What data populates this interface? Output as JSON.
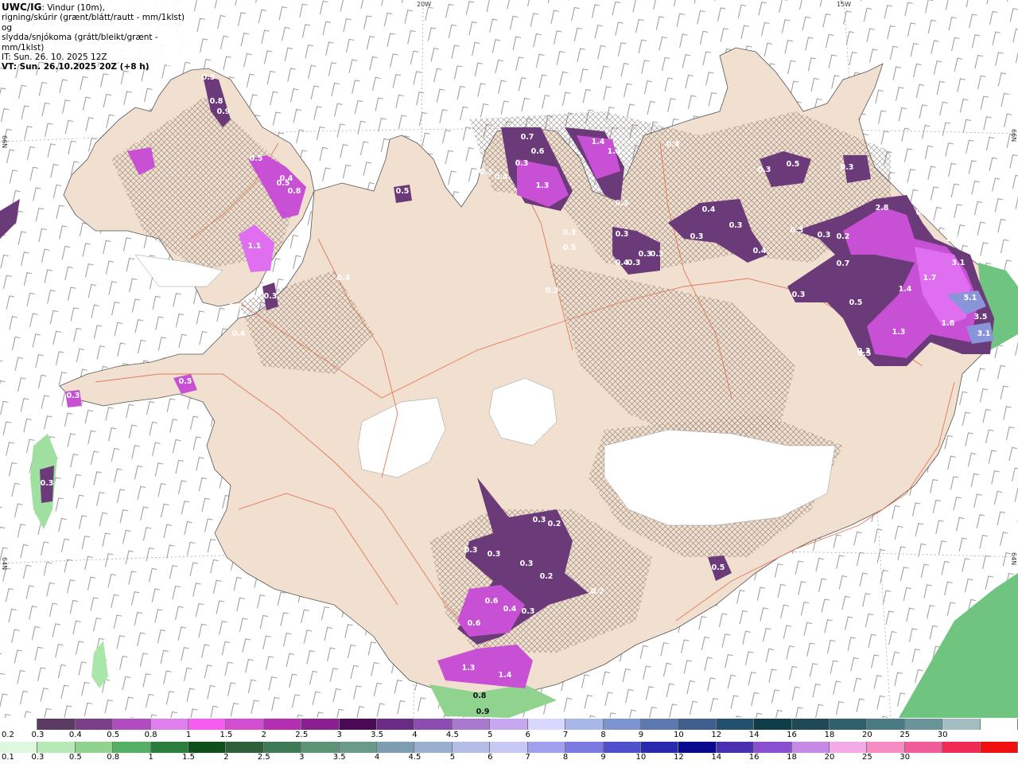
{
  "header": {
    "title": "UWC/IG",
    "title_rest": ": Vindur (10m),",
    "line2": "rigning/skúrir (grænt/blátt/rautt - mm/1klst) og",
    "line3": "slydda/snjókoma (grátt/bleikt/grænt - mm/1klst)",
    "it": "IT: Sun. 26. 10. 2025 12Z",
    "vt": "VT: Sun. 26.10.2025 20Z (+8 h)"
  },
  "coords": {
    "lon_20w": "20W",
    "lon_15w": "15W",
    "lat_66n_left": "66N",
    "lat_66n_right": "66N",
    "lat_64n_left": "64N",
    "lat_64n_right": "64N"
  },
  "precip_labels": [
    "0.4",
    "0.5",
    "0.8",
    "0.9",
    "0.3",
    "0.5",
    "0.4",
    "0.8",
    "0.5",
    "1.1",
    "0.3",
    "0.4",
    "0.5",
    "0.3",
    "0.8",
    "0.7",
    "0.6",
    "0.3",
    "0.4",
    "1.3",
    "0.3",
    "1.4",
    "1.4",
    "0.3",
    "0.4",
    "0.3",
    "0.5",
    "0.3",
    "0.3",
    "0.4",
    "0.3",
    "0.4",
    "0.3",
    "0.5",
    "0.3",
    "0.3",
    "0.3",
    "0.3",
    "0.4",
    "0.3",
    "0.3",
    "0.4",
    "2.8",
    "0.5",
    "2.9",
    "3.1",
    "1.7",
    "1.4",
    "5.1",
    "3.5",
    "1.8",
    "3.1",
    "1.3",
    "0.5",
    "0.7",
    "0.3",
    "0.5",
    "0.5",
    "0.3",
    "0.2",
    "0.3",
    "0.3",
    "0.3",
    "0.2",
    "0.2",
    "0.6",
    "0.4",
    "0.3",
    "0.6",
    "1.3",
    "1.4",
    "0.8",
    "0.9",
    "0.5",
    "0.3",
    "0.2",
    "0.3",
    "0.3"
  ],
  "legend": {
    "snow_colors": [
      "#ffffff",
      "#5a3a63",
      "#7a3f88",
      "#b04bc0",
      "#e07fee",
      "#f55cf0",
      "#d24dcf",
      "#b32fb0",
      "#8a1f8f",
      "#4a0a55",
      "#6a2b85",
      "#8c4db0",
      "#a77ad0",
      "#c7a8f0",
      "#d8d8ff",
      "#a7b7e8",
      "#7b93cf",
      "#5e78b0",
      "#3f5e8e",
      "#23506c",
      "#0e3d48",
      "#1f4a55",
      "#30606a",
      "#4a7a82",
      "#6b949a",
      "#a3bdc0",
      "#ffffff"
    ],
    "snow_ticks": [
      "0.2",
      "0.3",
      "0.4",
      "0.5",
      "0.8",
      "1",
      "1.5",
      "2",
      "2.5",
      "3",
      "3.5",
      "4",
      "4.5",
      "5",
      "6",
      "7",
      "8",
      "9",
      "10",
      "12",
      "14",
      "16",
      "18",
      "20",
      "25",
      "30"
    ],
    "rain_colors": [
      "#dff7df",
      "#b6e9b6",
      "#8fd38f",
      "#55b065",
      "#2a7d3a",
      "#0f4f1a",
      "#2e5f3a",
      "#3e7a55",
      "#5d9478",
      "#6a9a8a",
      "#7f9db0",
      "#9aaed0",
      "#b3bde6",
      "#c8c8f5",
      "#a0a0ee",
      "#7a7ae0",
      "#5050cc",
      "#2a2ab0",
      "#0a0a90",
      "#4a2fb0",
      "#8a4fd0",
      "#c48ae6",
      "#f2a9e6",
      "#f58cc4",
      "#f05c9a",
      "#ee2a55",
      "#f01010"
    ],
    "rain_ticks": [
      "0.1",
      "0.3",
      "0.5",
      "0.8",
      "1",
      "1.5",
      "2",
      "2.5",
      "3",
      "3.5",
      "4",
      "4.5",
      "5",
      "6",
      "7",
      "8",
      "9",
      "10",
      "12",
      "14",
      "16",
      "18",
      "20",
      "25",
      "30"
    ]
  }
}
